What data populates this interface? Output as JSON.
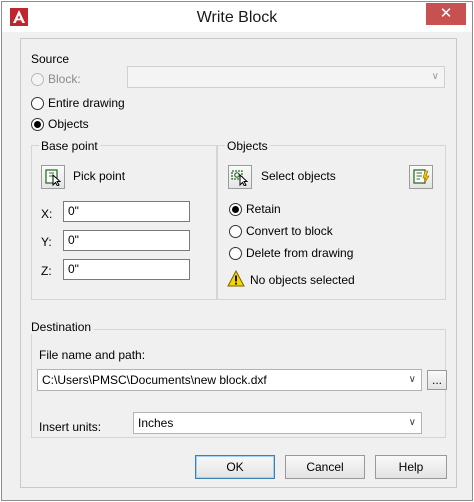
{
  "window": {
    "title": "Write Block",
    "close_glyph": "✕",
    "app_icon": "autocad-logo-icon",
    "accent": "#c0262d"
  },
  "source": {
    "label": "Source",
    "block_label": "Block:",
    "block_value": "",
    "entire_drawing_label": "Entire drawing",
    "objects_label": "Objects",
    "selected": "objects"
  },
  "base_point": {
    "label": "Base point",
    "pick_point_label": "Pick point",
    "x_label": "X:",
    "x_value": "0\"",
    "y_label": "Y:",
    "y_value": "0\"",
    "z_label": "Z:",
    "z_value": "0\""
  },
  "objects": {
    "label": "Objects",
    "select_objects_label": "Select objects",
    "retain_label": "Retain",
    "convert_label": "Convert to block",
    "delete_label": "Delete from drawing",
    "selected_option": "retain",
    "status_text": "No objects selected",
    "warning_color": "#f5d400"
  },
  "destination": {
    "label": "Destination",
    "file_label": "File name and path:",
    "file_value": "C:\\Users\\PMSC\\Documents\\new block.dxf",
    "browse_label": "...",
    "units_label": "Insert units:",
    "units_value": "Inches"
  },
  "buttons": {
    "ok": "OK",
    "cancel": "Cancel",
    "help": "Help"
  }
}
